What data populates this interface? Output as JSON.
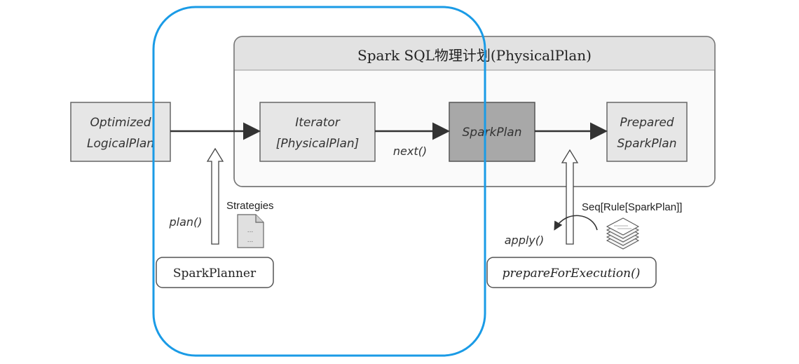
{
  "title": "Spark SQL物理计划(PhysicalPlan)",
  "nodes": {
    "optimized_line1": "Optimized",
    "optimized_line2": "LogicalPlan",
    "iterator_line1": "Iterator",
    "iterator_line2": "[PhysicalPlan]",
    "sparkplan": "SparkPlan",
    "prepared_line1": "Prepared",
    "prepared_line2": "SparkPlan"
  },
  "labels": {
    "next": "next()",
    "plan": "plan()",
    "strategies": "Strategies",
    "spark_planner": "SparkPlanner",
    "seq_rule": "Seq[Rule[SparkPlan]]",
    "apply": "apply()",
    "prepare_for_execution": "prepareForExecution()"
  },
  "colors": {
    "highlight_outline": "#1a9be6",
    "box_fill": "#e6e6e6",
    "dark_box_fill": "#a8a8a8",
    "header_fill": "#e2e2e2"
  }
}
